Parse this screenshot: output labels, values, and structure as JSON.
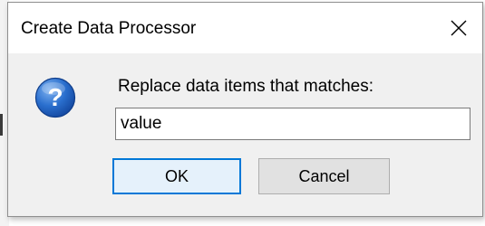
{
  "dialog": {
    "title": "Create Data Processor",
    "close_icon": "close-icon",
    "message_icon": "question-icon",
    "prompt": "Replace data items that matches:",
    "input_value": "value",
    "ok_label": "OK",
    "cancel_label": "Cancel"
  },
  "colors": {
    "dialog_bg": "#f0f0f0",
    "title_bg": "#ffffff",
    "accent": "#0078d7",
    "ok_bg": "#e5f1fb",
    "icon_blue": "#1f67c4"
  }
}
